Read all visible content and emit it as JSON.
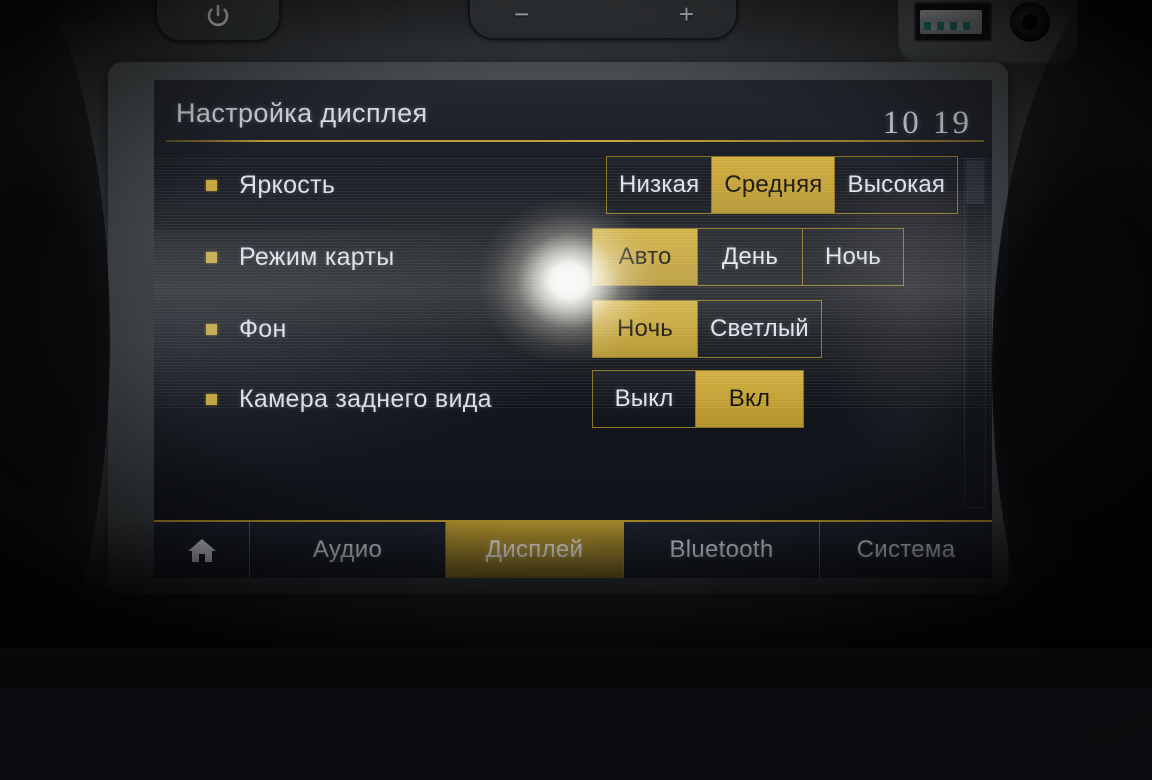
{
  "hardware": {
    "power_button": {
      "name": "power-button",
      "glyph": "power-symbol"
    },
    "volume_rocker": {
      "minus": "−",
      "plus": "+"
    },
    "eject_icon": "eject-disc-icon",
    "usb_port": "usb-port",
    "aux_jack": "aux-jack"
  },
  "screen": {
    "title": "Настройка дисплея",
    "clock": "10 19",
    "accent_color": "#c6a436",
    "text_color": "#e0e5ea",
    "background_color": "#15181f"
  },
  "settings": [
    {
      "label": "Яркость",
      "name": "brightness",
      "selected": "Средняя",
      "options": [
        {
          "label": "Низкая",
          "selected": false
        },
        {
          "label": "Средняя",
          "selected": true
        },
        {
          "label": "Высокая",
          "selected": false
        }
      ]
    },
    {
      "label": "Режим карты",
      "name": "map-mode",
      "selected": "Авто",
      "options": [
        {
          "label": "Авто",
          "selected": true
        },
        {
          "label": "День",
          "selected": false
        },
        {
          "label": "Ночь",
          "selected": false
        }
      ]
    },
    {
      "label": "Фон",
      "name": "background",
      "selected": "Ночь",
      "options": [
        {
          "label": "Ночь",
          "selected": true
        },
        {
          "label": "Светлый",
          "selected": false
        }
      ]
    },
    {
      "label": "Камера заднего вида",
      "name": "rear-view-camera",
      "selected": "Вкл",
      "options": [
        {
          "label": "Выкл",
          "selected": false
        },
        {
          "label": "Вкл",
          "selected": true
        }
      ]
    }
  ],
  "tabs": [
    {
      "label": "",
      "name": "home",
      "icon": "home-icon",
      "active": false
    },
    {
      "label": "Аудио",
      "name": "audio",
      "active": false
    },
    {
      "label": "Дисплей",
      "name": "display",
      "active": true
    },
    {
      "label": "Bluetooth",
      "name": "bluetooth",
      "active": false
    },
    {
      "label": "Система",
      "name": "system",
      "active": false
    }
  ]
}
